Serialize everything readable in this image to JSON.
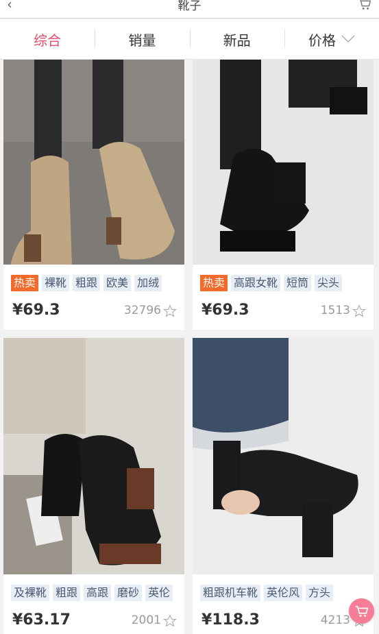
{
  "header": {
    "back_icon": "chevron-left-icon",
    "title": "靴子",
    "cart_icon": "cart-icon"
  },
  "tabs": [
    {
      "label": "综合",
      "active": true
    },
    {
      "label": "销量",
      "active": false
    },
    {
      "label": "新品",
      "active": false
    },
    {
      "label": "价格",
      "active": false
    }
  ],
  "colors": {
    "accent": "#ea4a6a",
    "hot": "#f36a2a",
    "tag_bg": "#e8eef6",
    "fab": "#f57d96"
  },
  "products": [
    {
      "tags": [
        "热卖",
        "裸靴",
        "粗跟",
        "欧美",
        "加绒"
      ],
      "hot": true,
      "price": "¥69.3",
      "count": "32796"
    },
    {
      "tags": [
        "热卖",
        "高跟女靴",
        "短筒",
        "尖头"
      ],
      "hot": true,
      "price": "¥69.3",
      "count": "1513"
    },
    {
      "tags": [
        "及裸靴",
        "粗跟",
        "高跟",
        "磨砂",
        "英伦"
      ],
      "hot": false,
      "price": "¥63.17",
      "count": "2001"
    },
    {
      "tags": [
        "粗跟机车靴",
        "英伦风",
        "方头"
      ],
      "hot": false,
      "price": "¥118.3",
      "count": "4213"
    }
  ]
}
